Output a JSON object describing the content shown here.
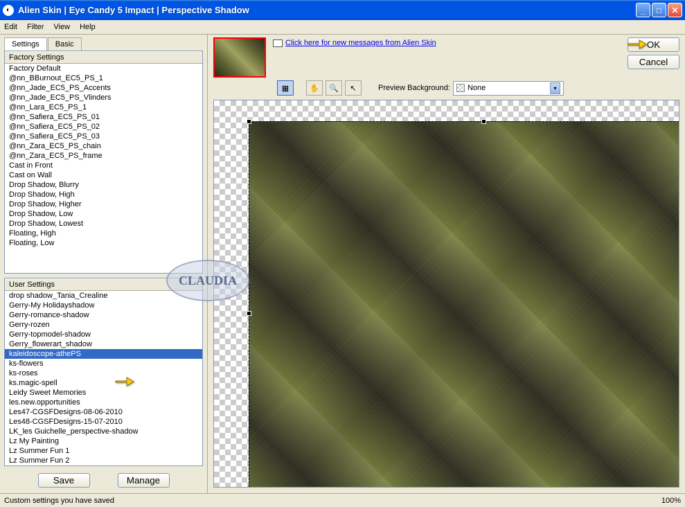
{
  "title": "Alien Skin  |  Eye Candy 5 Impact  |  Perspective Shadow",
  "menu": {
    "edit": "Edit",
    "filter": "Filter",
    "view": "View",
    "help": "Help"
  },
  "tabs": {
    "settings": "Settings",
    "basic": "Basic"
  },
  "factory": {
    "header": "Factory Settings",
    "items": [
      "Factory Default",
      "@nn_BBurnout_EC5_PS_1",
      "@nn_Jade_EC5_PS_Accents",
      "@nn_Jade_EC5_PS_Vlinders",
      "@nn_Lara_EC5_PS_1",
      "@nn_Safiera_EC5_PS_01",
      "@nn_Safiera_EC5_PS_02",
      "@nn_Safiera_EC5_PS_03",
      "@nn_Zara_EC5_PS_chain",
      "@nn_Zara_EC5_PS_frame",
      "Cast in Front",
      "Cast on Wall",
      "Drop Shadow, Blurry",
      "Drop Shadow, High",
      "Drop Shadow, Higher",
      "Drop Shadow, Low",
      "Drop Shadow, Lowest",
      "Floating, High",
      "Floating, Low"
    ]
  },
  "user": {
    "header": "User Settings",
    "items": [
      "drop shadow_Tania_Crealine",
      "Gerry-My Holidayshadow",
      "Gerry-romance-shadow",
      "Gerry-rozen",
      "Gerry-topmodel-shadow",
      "Gerry_flowerart_shadow",
      "kaleidoscope-athePS",
      "ks-flowers",
      "ks-roses",
      "ks.magic-spell",
      "Leidy Sweet Memories",
      "les.new.opportunities",
      "Les47-CGSFDesigns-08-06-2010",
      "Les48-CGSFDesigns-15-07-2010",
      "LK_les Guichelle_perspective-shadow",
      "Lz My Painting",
      "Lz Summer Fun 1",
      "Lz Summer Fun 2"
    ],
    "selected_index": 6
  },
  "buttons": {
    "save": "Save",
    "manage": "Manage",
    "ok": "OK",
    "cancel": "Cancel"
  },
  "link": "Click here for new messages from Alien Skin",
  "preview_bg_label": "Preview Background:",
  "preview_bg_value": "None",
  "status": "Custom settings you have saved",
  "zoom": "100%",
  "watermark": "CLAUDIA"
}
